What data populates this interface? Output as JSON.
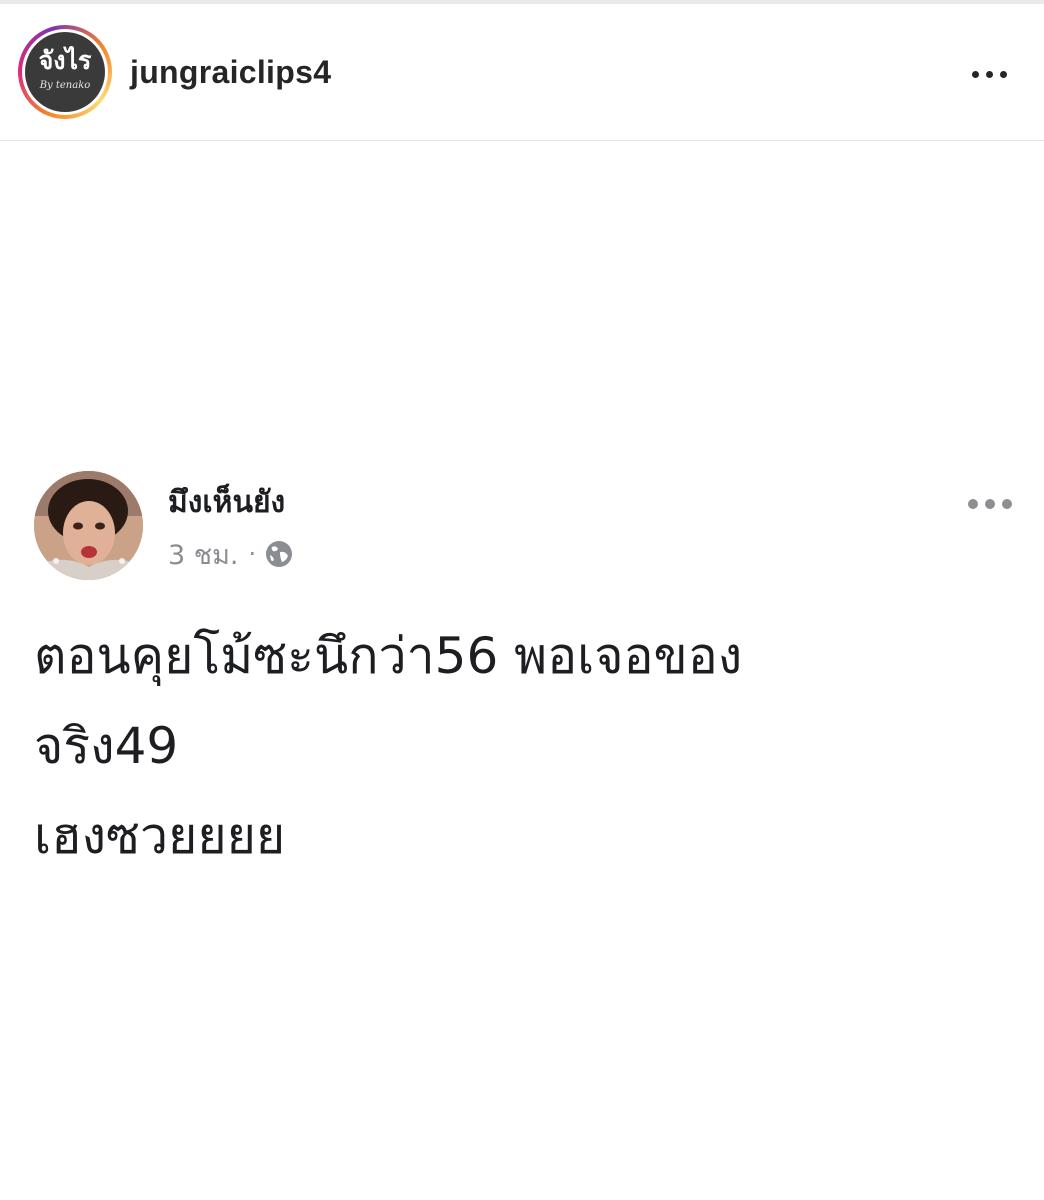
{
  "instagram_header": {
    "username": "jungraiclips4",
    "avatar_logo_text": "จังไร",
    "avatar_logo_subtext": "By tenako",
    "more_icon": "more-horizontal-icon"
  },
  "facebook_post": {
    "author_name": "มึงเห็นยัง",
    "timestamp": "3 ชม.",
    "separator": "·",
    "privacy_icon": "globe-icon",
    "more_icon": "more-horizontal-icon",
    "text_lines": [
      "ตอนคุยโม้ซะนึกว่า56 พอเจอของ",
      "จริง49",
      "เฮงซวยยยย"
    ]
  }
}
